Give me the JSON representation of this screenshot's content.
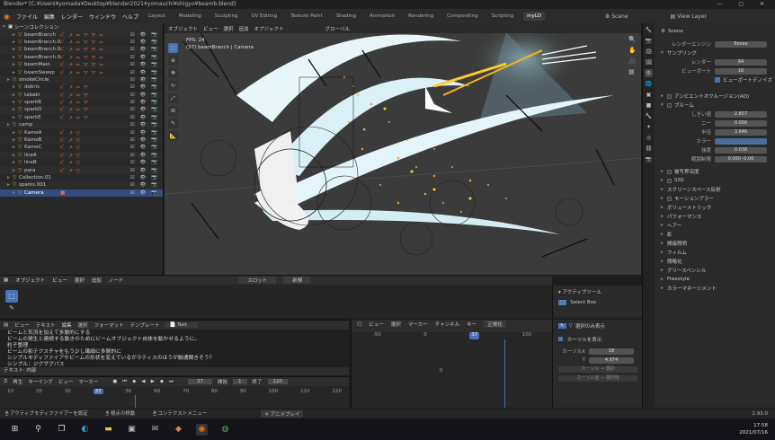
{
  "window_title": "Blender* [C:¥Users¥yomada¥Desktop¥blender2021¥yomauchi¥shigyo¥beamb.blend]",
  "menu": [
    "ファイル",
    "編集",
    "レンダー",
    "ウィンドウ",
    "ヘルプ"
  ],
  "workspaces": [
    "Layout",
    "Modeling",
    "Sculpting",
    "UV Editing",
    "Texture Paint",
    "Shading",
    "Animation",
    "Rendering",
    "Compositing",
    "Scripting",
    "myLO"
  ],
  "active_workspace": "myLO",
  "scene_name": "Scene",
  "view_layer": "View Layer",
  "outliner": {
    "root": "シーンコレクション",
    "items": [
      {
        "label": "beamBranch",
        "mods": "ﾊﾞ ↗ ✂ ♈ ♈ ✂"
      },
      {
        "label": "beamBranch.001",
        "mods": "ﾊﾞ ↗ ✂ ♈ ♈ ✂"
      },
      {
        "label": "beamBranch.002",
        "mods": "ﾊﾞ ↗ ✂ ♈ ♈ ✂"
      },
      {
        "label": "beamBranch.003",
        "mods": "ﾊﾞ ↗ ✂ ♈ ♈ ✂"
      },
      {
        "label": "beamMain",
        "mods": "ﾊﾞ ↗ ✂ ♈ ♈ ✂"
      },
      {
        "label": "beamSweep",
        "mods": "ﾊﾞ ↗ ✂ ♈ ♈ ✂"
      },
      {
        "label": "smokeCircle",
        "mods": ""
      },
      {
        "label": "debris",
        "mods": "ﾊﾞ ↗ ✂ ♈"
      },
      {
        "label": "tabaki",
        "mods": "ﾊﾞ ↗ ✂ ♈"
      },
      {
        "label": "sparkB",
        "mods": "ﾊﾞ ↗ ✂ ♈"
      },
      {
        "label": "sparkD",
        "mods": "ﾊﾞ ↗ ✂ ♈"
      },
      {
        "label": "sparkE",
        "mods": "ﾊﾞ ↗ ✂ ♈"
      },
      {
        "label": "camp",
        "mods": ""
      },
      {
        "label": "KameA",
        "mods": "ﾊﾞ ↗ ▽"
      },
      {
        "label": "KameB",
        "mods": "ﾊﾞ ↗ ▽"
      },
      {
        "label": "KameC",
        "mods": "ﾊﾞ ↗ ▽"
      },
      {
        "label": "lineA",
        "mods": "ﾊﾞ ↗ ▽"
      },
      {
        "label": "lineB",
        "mods": "ﾊﾞ ↗ ▽"
      },
      {
        "label": "para",
        "mods": "ﾊﾞ ↗ ▽"
      },
      {
        "label": "Collection.01",
        "mods": ""
      },
      {
        "label": "sparks.001",
        "mods": ""
      },
      {
        "label": "Camera",
        "mods": "■"
      }
    ],
    "selected_index": 21
  },
  "viewport": {
    "header": [
      "オブジェクト",
      "ビュー",
      "選択",
      "追加",
      "オブジェクト",
      "グローバル"
    ],
    "fps": "FPS: 24",
    "object_label": "(37) beamBranch | Camera"
  },
  "properties": {
    "scene_label": "Scene",
    "render_engine_label": "レンダーエンジン",
    "render_engine": "Eevee",
    "sampling": "サンプリング",
    "render_label": "レンダー",
    "render_samples": "64",
    "viewport_label": "ビューポート",
    "viewport_samples": "16",
    "viewport_denoise": "ビューポートデノイズ",
    "sections": [
      "アンビエントオクルージョン(AO)",
      "ブルーム"
    ],
    "bloom_fields": [
      {
        "label": "しきい値",
        "value": "2.857"
      },
      {
        "label": "ニー",
        "value": "0.000"
      },
      {
        "label": "半径",
        "value": "3.646"
      },
      {
        "label": "カラー",
        "value": ""
      },
      {
        "label": "強度",
        "value": "0.038"
      },
      {
        "label": "範囲制限",
        "value": "0.000 -0.00"
      }
    ],
    "more_sections": [
      "被写界深度",
      "SSS",
      "スクリーンスペース反射",
      "モーションブラー",
      "ボリューメトリック",
      "パフォーマンス",
      "ヘアー",
      "影",
      "間接照明",
      "フィルム",
      "簡略化",
      "グリースペンシル",
      "Freestyle",
      "カラーマネージメント"
    ]
  },
  "timeline": {
    "header": [
      "オブジェクト",
      "ビュー",
      "選択",
      "追加",
      "ノード"
    ],
    "slot": "スロット",
    "new_button": "新規"
  },
  "active_tool": {
    "title": "アクティブツール",
    "tool": "Select Box"
  },
  "text_editor": {
    "header": [
      "ビュー",
      "テキスト",
      "編集",
      "選択",
      "フォーマット",
      "テンプレート"
    ],
    "file_name": "Text",
    "lines": [
      "ビームと気流を加えて多層的にする",
      "ビームの発生と連続する動きのためにビームオブジェクト自体を動かせるように。",
      "粒子整理",
      "ビームの影テクスチャをもう少し繊細に多層的に",
      "シンプルモディファイアやビームの形状を変えているがラティスのほうが融通聞きそう？",
      "シンプル：ジグザグパス"
    ],
    "status": "テキスト: 内部"
  },
  "graph": {
    "header": [
      "ビュー",
      "選択",
      "マーカー",
      "チャンネル",
      "キー",
      "正規化"
    ],
    "ruler": [
      "-50",
      "0",
      "37",
      "100"
    ],
    "active_frame": "37"
  },
  "sidepanel": {
    "only_selected": "選択のみ表示",
    "cursor_label": "カーソルを表示",
    "cursor_x_label": "カーソルX",
    "cursor_x": "18",
    "cursor_y_label": "Y",
    "cursor_y": "4.974",
    "btn1": "カーソル → 選択",
    "btn2": "カーソル値 → 選択物"
  },
  "playback": {
    "header": [
      "再生",
      "キーイング",
      "ビュー",
      "マーカー"
    ],
    "current_frame": "37",
    "start_label": "開始",
    "start": "1",
    "end_label": "終了",
    "end": "120",
    "ruler": [
      "10",
      "20",
      "30",
      "37",
      "50",
      "60",
      "70",
      "80",
      "90",
      "100",
      "110",
      "120"
    ]
  },
  "statusbar": {
    "left": "アクティブモディファイアーを設定",
    "middle": "視点の移動",
    "right": "コンテクストメニュー",
    "anim": "アニメプレイ",
    "version": "2.93.0"
  },
  "clock": {
    "time": "17:58",
    "date": "2021/07/16"
  },
  "colors": {
    "accent": "#4772b3",
    "selected_row": "#334d80"
  }
}
